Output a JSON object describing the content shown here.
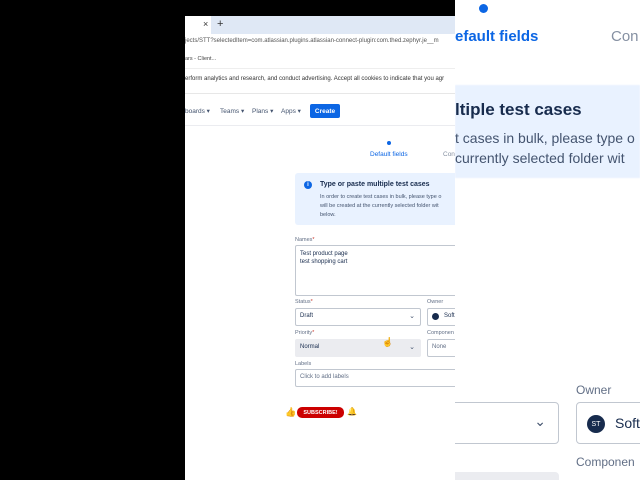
{
  "background": {
    "steps": {
      "active": "efault fields",
      "next": "Con"
    },
    "info_title": "ltiple test cases",
    "info_lines": [
      "t cases in bulk, please type o",
      "currently selected folder wit"
    ],
    "owner_label": "Owner",
    "owner_value": "Soft",
    "owner_initials": "ST",
    "component_label": "Componen"
  },
  "browser": {
    "tab_close": "×",
    "new_tab": "+",
    "url": "jects/STT?selectedItem=com.atlassian.plugins.atlassian-connect-plugin:com.thed.zephyr.je__m",
    "bookmark": "ars - Client..."
  },
  "cookie_banner": {
    "text": "erform analytics and research, and conduct advertising. Accept all cookies to indicate that you agr"
  },
  "nav": {
    "items": [
      "boards ▾",
      "Teams ▾",
      "Plans ▾",
      "Apps ▾"
    ],
    "create": "Create"
  },
  "wizard": {
    "step_active": "Default fields",
    "step_next": "Con"
  },
  "info_panel": {
    "icon": "i",
    "title": "Type or paste multiple test cases",
    "lines": [
      "In order to create test cases in bulk, please type o",
      "will be created at the currently selected folder wit",
      "below."
    ]
  },
  "form": {
    "names_label": "Names",
    "names_required": "*",
    "names_lines": [
      "Test product page",
      "test shopping cart"
    ],
    "status_label": "Status",
    "status_required": "*",
    "status_value": "Draft",
    "owner_label": "Owner",
    "owner_value": "Soft",
    "priority_label": "Priority",
    "priority_required": "*",
    "priority_value": "Normal",
    "components_label": "Componen",
    "components_value": "None",
    "labels_label": "Labels",
    "labels_placeholder": "Click to add labels"
  },
  "overlay": {
    "subscribe": "SUBSCRIBE!",
    "thumb_icon": "thumbs-up-icon",
    "bell_icon": "bell-icon"
  },
  "colors": {
    "accent": "#0c66e4",
    "subscribe": "#cc0000",
    "info_bg": "#e9f2ff"
  }
}
